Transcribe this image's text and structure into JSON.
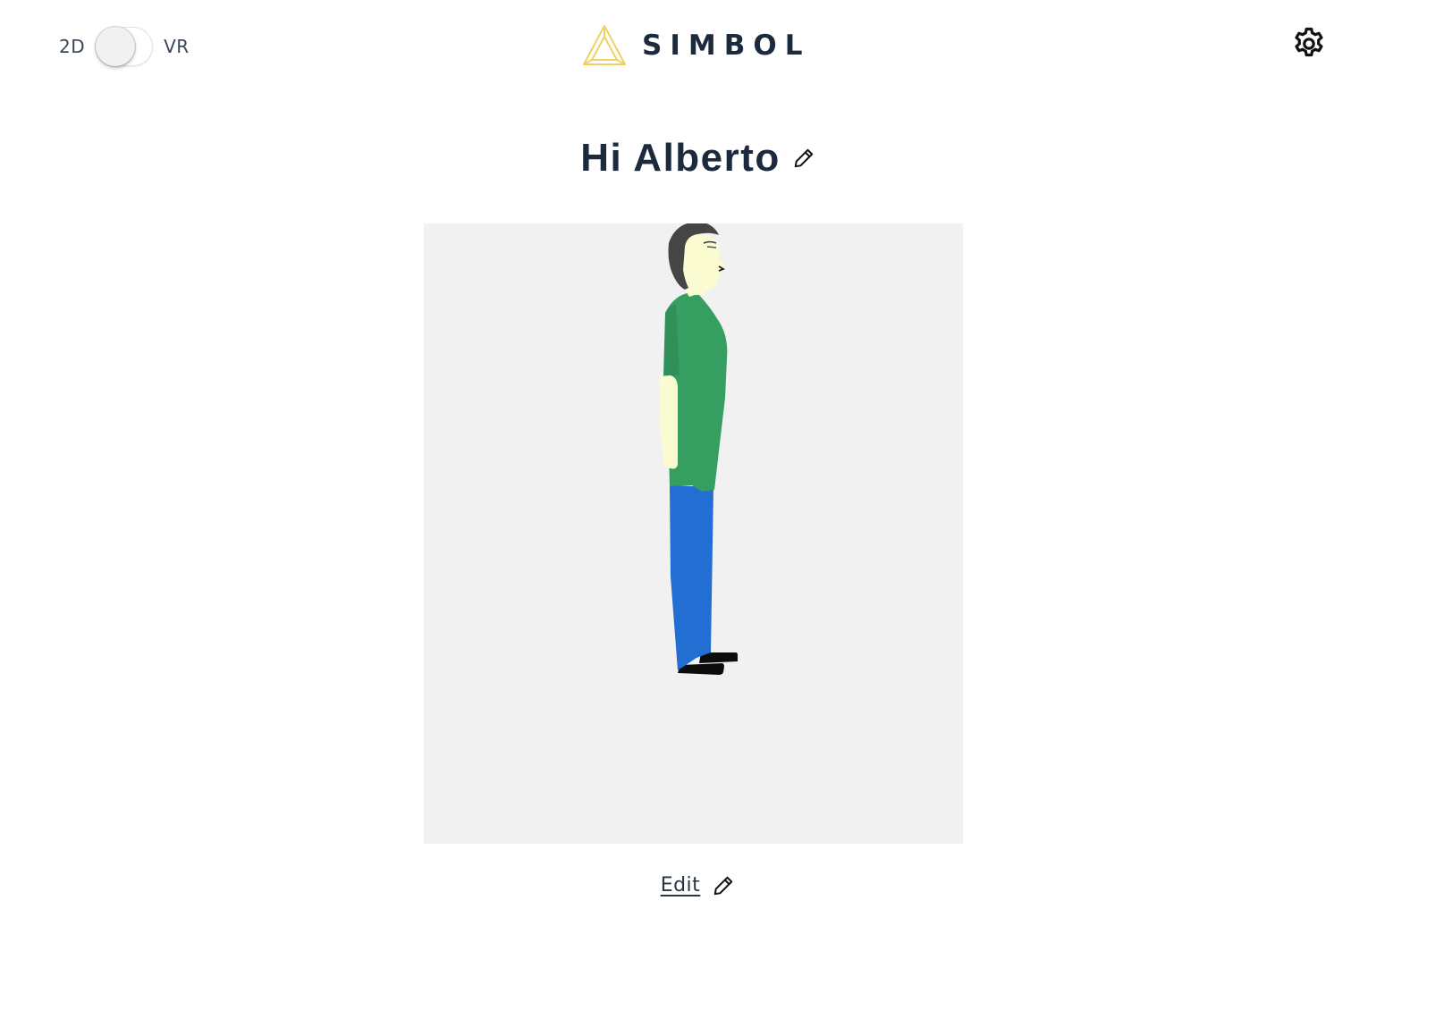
{
  "header": {
    "mode_toggle": {
      "left_label": "2D",
      "right_label": "VR",
      "selected": "2D"
    },
    "brand": {
      "name": "SIMBOL",
      "logo_icon": "triangle-logo-icon",
      "logo_color": "#f0d264"
    },
    "settings_icon": "gear-icon"
  },
  "greeting": {
    "text": "Hi Alberto",
    "edit_icon": "pencil-icon"
  },
  "avatar_viewer": {
    "background": "#f1f1f1",
    "colors": {
      "hair": "#454545",
      "skin": "#fbfbd2",
      "shirt": "#379e61",
      "pants": "#226ed3",
      "shoes": "#0c0c0c"
    }
  },
  "footer": {
    "edit_label": "Edit",
    "edit_icon": "pencil-icon"
  },
  "colors": {
    "text_primary": "#1b2a3c",
    "accent": "#f0d264"
  }
}
